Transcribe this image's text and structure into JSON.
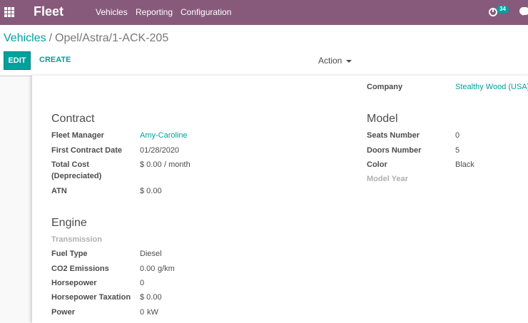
{
  "navbar": {
    "brand": "Fleet",
    "menu": [
      "Vehicles",
      "Reporting",
      "Configuration"
    ],
    "activity_count": "34"
  },
  "breadcrumb": {
    "parent": "Vehicles",
    "separator": "/",
    "current": "Opel/Astra/1-ACK-205"
  },
  "buttons": {
    "edit": "EDIT",
    "create": "CREATE",
    "action": "Action"
  },
  "form": {
    "company_label": "Company",
    "company_value": "Stealthy Wood (USA)",
    "contract": {
      "title": "Contract",
      "fleet_manager_label": "Fleet Manager",
      "fleet_manager_value": "Amy-Caroline",
      "first_contract_date_label": "First Contract Date",
      "first_contract_date_value": "01/28/2020",
      "total_cost_label_line1": "Total Cost",
      "total_cost_label_line2": "(Depreciated)",
      "total_cost_value": "$ 0.00",
      "total_cost_unit": "/ month",
      "atn_label": "ATN",
      "atn_value": "$ 0.00"
    },
    "model": {
      "title": "Model",
      "seats_label": "Seats Number",
      "seats_value": "0",
      "doors_label": "Doors Number",
      "doors_value": "5",
      "color_label": "Color",
      "color_value": "Black",
      "model_year_label": "Model Year"
    },
    "engine": {
      "title": "Engine",
      "transmission_label": "Transmission",
      "fuel_type_label": "Fuel Type",
      "fuel_type_value": "Diesel",
      "co2_label": "CO2 Emissions",
      "co2_value": "0.00",
      "co2_unit": "g/km",
      "horsepower_label": "Horsepower",
      "horsepower_value": "0",
      "horsepower_tax_label": "Horsepower Taxation",
      "horsepower_tax_value": "$ 0.00",
      "power_label": "Power",
      "power_value": "0",
      "power_unit": "kW"
    }
  },
  "colors": {
    "navbar": "#875a7b",
    "accent": "#00a09d"
  }
}
